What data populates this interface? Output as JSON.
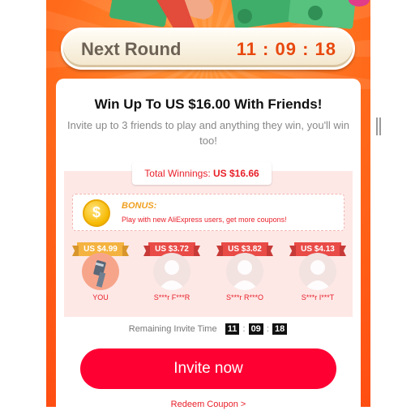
{
  "header": {
    "round_label": "Next Round",
    "round_time": "11 : 09 : 18"
  },
  "card": {
    "title": "Win Up To US $16.00 With Friends!",
    "subtitle": "Invite up to 3 friends to play and anything they win, you'll win too!",
    "winnings_label": "Total Winnings: ",
    "winnings_value": "US $16.66",
    "bonus_title": "BONUS:",
    "bonus_text": "Play with new AliExpress users, get more coupons!",
    "friends": [
      {
        "amount": "US $4.99",
        "name": "YOU"
      },
      {
        "amount": "US $3.72",
        "name": "S***r F***R"
      },
      {
        "amount": "US $3.82",
        "name": "S***r R***O"
      },
      {
        "amount": "US $4.13",
        "name": "S***r I***T"
      }
    ],
    "remaining_label": "Remaining Invite Time",
    "remaining_h": "11",
    "remaining_m": "09",
    "remaining_s": "18",
    "invite_button": "Invite now",
    "redeem_link": "Redeem Coupon >"
  },
  "colors": {
    "accent": "#ff0033",
    "background": "#ff5a18",
    "round_time": "#e8480e"
  }
}
